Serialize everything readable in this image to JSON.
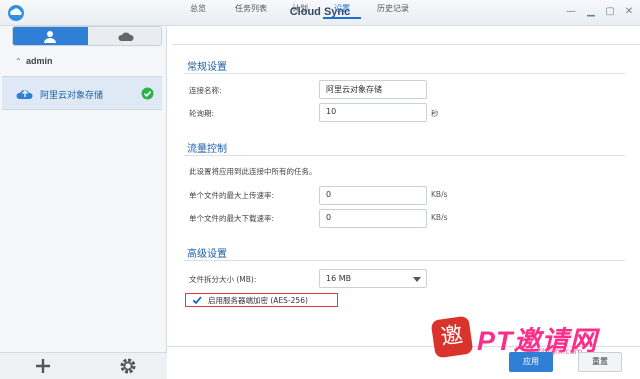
{
  "window": {
    "title": "Cloud Sync"
  },
  "sidebar": {
    "account": "admin",
    "connections": [
      {
        "label": "阿里云对象存储",
        "status": "ok"
      }
    ]
  },
  "tabs": [
    {
      "label": "总览",
      "active": false
    },
    {
      "label": "任务列表",
      "active": false
    },
    {
      "label": "计划",
      "active": false
    },
    {
      "label": "设置",
      "active": true
    },
    {
      "label": "历史记录",
      "active": false
    }
  ],
  "general": {
    "title": "常规设置",
    "conn_name_label": "连接名称:",
    "conn_name_value": "阿里云对象存储",
    "poll_label": "轮询期:",
    "poll_value": "10",
    "poll_unit": "秒"
  },
  "traffic": {
    "title": "流量控制",
    "desc": "此设置将应用到此连接中所有的任务。",
    "upload_label": "单个文件的最大上传速率:",
    "upload_value": "0",
    "upload_unit": "KB/s",
    "download_label": "单个文件的最大下载速率:",
    "download_value": "0",
    "download_unit": "KB/s"
  },
  "advanced": {
    "title": "高级设置",
    "split_label": "文件拆分大小 (MB):",
    "split_value": "16 MB",
    "encrypt_label": "启用服务器端加密 (AES-256)",
    "encrypt_checked": true
  },
  "buttons": {
    "apply": "应用",
    "reset": "重置"
  },
  "watermark": {
    "seal_char": "邀",
    "brand": "PT邀请网",
    "url": "ptyqm.com"
  },
  "colors": {
    "accent": "#1c6fd1",
    "highlight": "#e0393e",
    "ok": "#2bb24c"
  }
}
